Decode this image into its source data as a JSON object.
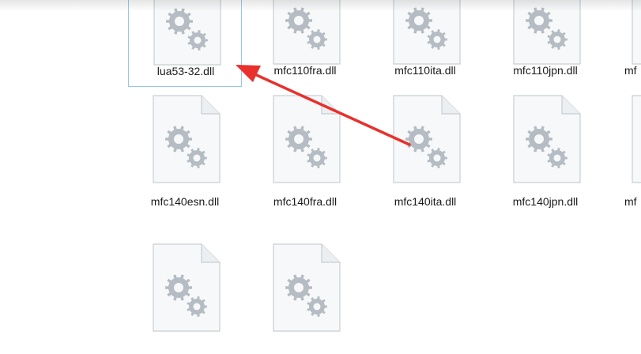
{
  "files": [
    {
      "name": "lua53-32.dll",
      "selected": true
    },
    {
      "name": "mfc110fra.dll"
    },
    {
      "name": "mfc110ita.dll"
    },
    {
      "name": "mfc110jpn.dll"
    },
    {
      "name": "mf"
    },
    {
      "name": "mfc140esn.dll"
    },
    {
      "name": "mfc140fra.dll"
    },
    {
      "name": "mfc140ita.dll"
    },
    {
      "name": "mfc140jpn.dll"
    },
    {
      "name": "mf"
    },
    {
      "name": ""
    },
    {
      "name": ""
    }
  ],
  "file_icon": "dll-settings-file-icon",
  "annotation": {
    "type": "arrow",
    "color": "#e8302c"
  },
  "colors": {
    "selection_border": "#99c6ee",
    "gear": "#b5bcc3"
  }
}
